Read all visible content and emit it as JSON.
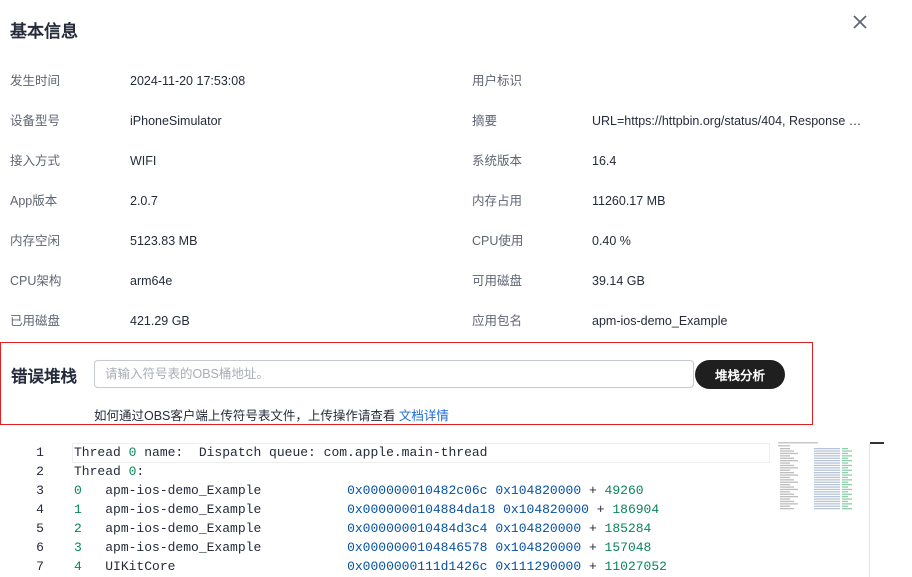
{
  "header": {
    "title": "基本信息"
  },
  "info": [
    {
      "left": {
        "label": "发生时间",
        "value": "2024-11-20 17:53:08"
      },
      "right": {
        "label": "用户标识",
        "value": ""
      }
    },
    {
      "left": {
        "label": "设备型号",
        "value": "iPhoneSimulator"
      },
      "right": {
        "label": "摘要",
        "value": "URL=https://httpbin.org/status/404, Response C..."
      }
    },
    {
      "left": {
        "label": "接入方式",
        "value": "WIFI"
      },
      "right": {
        "label": "系统版本",
        "value": "16.4"
      }
    },
    {
      "left": {
        "label": "App版本",
        "value": "2.0.7"
      },
      "right": {
        "label": "内存占用",
        "value": "11260.17 MB"
      }
    },
    {
      "left": {
        "label": "内存空闲",
        "value": "5123.83 MB"
      },
      "right": {
        "label": "CPU使用",
        "value": "0.40 %"
      }
    },
    {
      "left": {
        "label": "CPU架构",
        "value": "arm64e"
      },
      "right": {
        "label": "可用磁盘",
        "value": "39.14 GB"
      }
    },
    {
      "left": {
        "label": "已用磁盘",
        "value": "421.29 GB"
      },
      "right": {
        "label": "应用包名",
        "value": "apm-ios-demo_Example"
      }
    }
  ],
  "stack": {
    "title": "错误堆栈",
    "input_placeholder": "请输入符号表的OBS桶地址。",
    "input_value": "",
    "analyze_label": "堆栈分析",
    "hint_text": "如何通过OBS客户端上传符号表文件，上传操作请查看 ",
    "hint_link": "文档详情"
  },
  "code": [
    {
      "n": "1",
      "parts": [
        [
          "t",
          "Thread "
        ],
        [
          "num",
          "0"
        ],
        [
          "t",
          " name:  Dispatch queue: com.apple.main-thread"
        ]
      ]
    },
    {
      "n": "2",
      "parts": [
        [
          "t",
          "Thread "
        ],
        [
          "num",
          "0"
        ],
        [
          "t",
          ":"
        ]
      ]
    },
    {
      "n": "3",
      "parts": [
        [
          "num",
          "0"
        ],
        [
          "t",
          "   apm-ios-demo_Example           "
        ],
        [
          "hex",
          "0x000000010482c06c"
        ],
        [
          "t",
          " "
        ],
        [
          "hex",
          "0x104820000"
        ],
        [
          "t",
          " + "
        ],
        [
          "num",
          "49260"
        ]
      ]
    },
    {
      "n": "4",
      "parts": [
        [
          "num",
          "1"
        ],
        [
          "t",
          "   apm-ios-demo_Example           "
        ],
        [
          "hex",
          "0x0000000104884da18"
        ],
        [
          "t",
          " "
        ],
        [
          "hex",
          "0x104820000"
        ],
        [
          "t",
          " + "
        ],
        [
          "num",
          "186904"
        ]
      ]
    },
    {
      "n": "5",
      "parts": [
        [
          "num",
          "2"
        ],
        [
          "t",
          "   apm-ios-demo_Example           "
        ],
        [
          "hex",
          "0x000000010484d3c4"
        ],
        [
          "t",
          " "
        ],
        [
          "hex",
          "0x104820000"
        ],
        [
          "t",
          " + "
        ],
        [
          "num",
          "185284"
        ]
      ]
    },
    {
      "n": "6",
      "parts": [
        [
          "num",
          "3"
        ],
        [
          "t",
          "   apm-ios-demo_Example           "
        ],
        [
          "hex",
          "0x0000000104846578"
        ],
        [
          "t",
          " "
        ],
        [
          "hex",
          "0x104820000"
        ],
        [
          "t",
          " + "
        ],
        [
          "num",
          "157048"
        ]
      ]
    },
    {
      "n": "7",
      "parts": [
        [
          "num",
          "4"
        ],
        [
          "t",
          "   UIKitCore                      "
        ],
        [
          "hex",
          "0x0000000111d1426c"
        ],
        [
          "t",
          " "
        ],
        [
          "hex",
          "0x111290000"
        ],
        [
          "t",
          " + "
        ],
        [
          "num",
          "11027052"
        ]
      ]
    }
  ],
  "colors": {
    "stack_box_border": "#e02020",
    "link": "#1a6bd6",
    "button_bg": "#1f1f1f"
  },
  "icons": {
    "close": "close-icon"
  }
}
